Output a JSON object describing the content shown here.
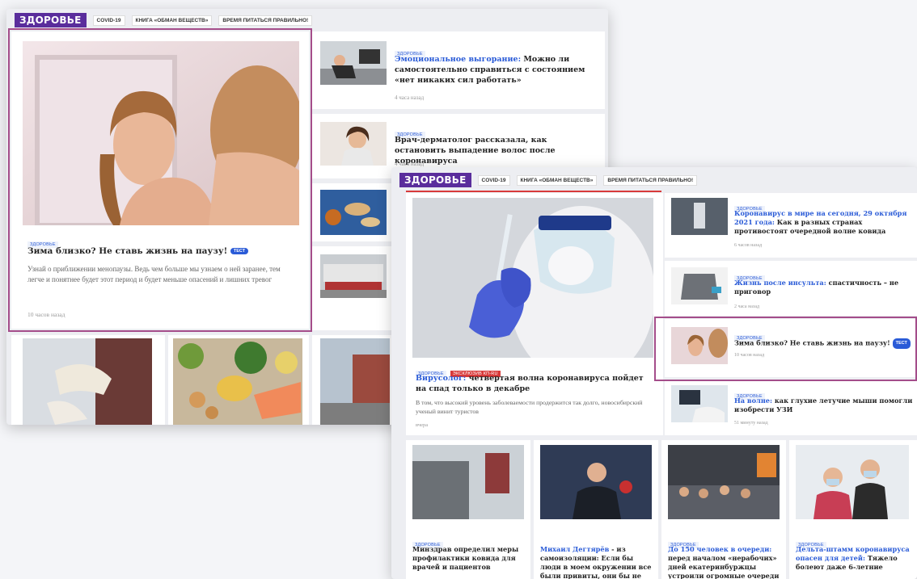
{
  "section_logo": "ЗДОРОВЬЕ",
  "nav": [
    "COVID-19",
    "КНИГА «ОБМАН ВЕЩЕСТВ»",
    "ВРЕМЯ ПИТАТЬСЯ ПРАВИЛЬНО!"
  ],
  "back": {
    "main": {
      "tag": "ЗДОРОВЬЕ",
      "title": "Зима близко? Не ставь жизнь на паузу!",
      "badge": "ТЕСТ",
      "excerpt": "Узнай о приближении менопаузы. Ведь чем больше мы узнаем о ней заранее, тем легче и понятнее будет этот период и будет меньше опасений и лишних тревог",
      "time": "10 часов назад"
    },
    "side": [
      {
        "tag": "ЗДОРОВЬЕ",
        "lead": "Эмоциональное выгорание:",
        "title": " Можно ли самостоятельно справиться с состоянием «нет никаких сил работать»",
        "time": "4 часа назад"
      },
      {
        "tag": "ЗДОРОВЬЕ",
        "lead": "",
        "title": "Врач-дерматолог рассказала, как остановить выпадение волос после коронавируса",
        "time": "4 часа назад"
      }
    ]
  },
  "front": {
    "main": {
      "tags": [
        "ЗДОРОВЬЕ",
        "ЭКСКЛЮЗИВ КП-RU"
      ],
      "lead": "Вирусолог:",
      "title": " четвертая волна коронавируса пойдет на спад только в декабре",
      "excerpt": "В том, что высокий уровень заболеваемости продержится так долго, новосибирский ученый винит туристов",
      "time": "вчера"
    },
    "side": [
      {
        "tag": "ЗДОРОВЬЕ",
        "lead": "Коронавирус в мире на сегодня, 29 октября 2021 года:",
        "title": " Как в разных странах противостоят очередной волне ковида",
        "time": "6 часов назад"
      },
      {
        "tag": "ЗДОРОВЬЕ",
        "lead": "Жизнь после инсульта:",
        "title": " спастичность – не приговор",
        "time": "2 часа назад"
      },
      {
        "tag": "ЗДОРОВЬЕ",
        "lead": "",
        "title": "Зима близко? Не ставь жизнь на паузу!",
        "badge": "ТЕСТ",
        "time": "10 часов назад"
      },
      {
        "tag": "ЗДОРОВЬЕ",
        "lead": "На волне:",
        "title": " как глухие летучие мыши помогли изобрести УЗИ",
        "time": "51 минуту назад"
      }
    ],
    "bottom": [
      {
        "tag": "ЗДОРОВЬЕ",
        "lead": "",
        "title": "Минздрав определил меры профилактики ковида для врачей и пациентов"
      },
      {
        "tag": "",
        "lead": "Михаил Дегтярёв",
        "title": " - из самоизоляции: Если бы люди в моем окружении все были привиты, они бы не"
      },
      {
        "tag": "ЗДОРОВЬЕ",
        "lead": "До 150 человек в очереди:",
        "title": " перед началом «нерабочих» дней екатеринбуржцы устроили огромные очереди"
      },
      {
        "tag": "ЗДОРОВЬЕ",
        "lead": "Дельта-штамм коронавируса опасен для детей:",
        "title": " Тяжело болеют даже 6-летние"
      }
    ]
  }
}
